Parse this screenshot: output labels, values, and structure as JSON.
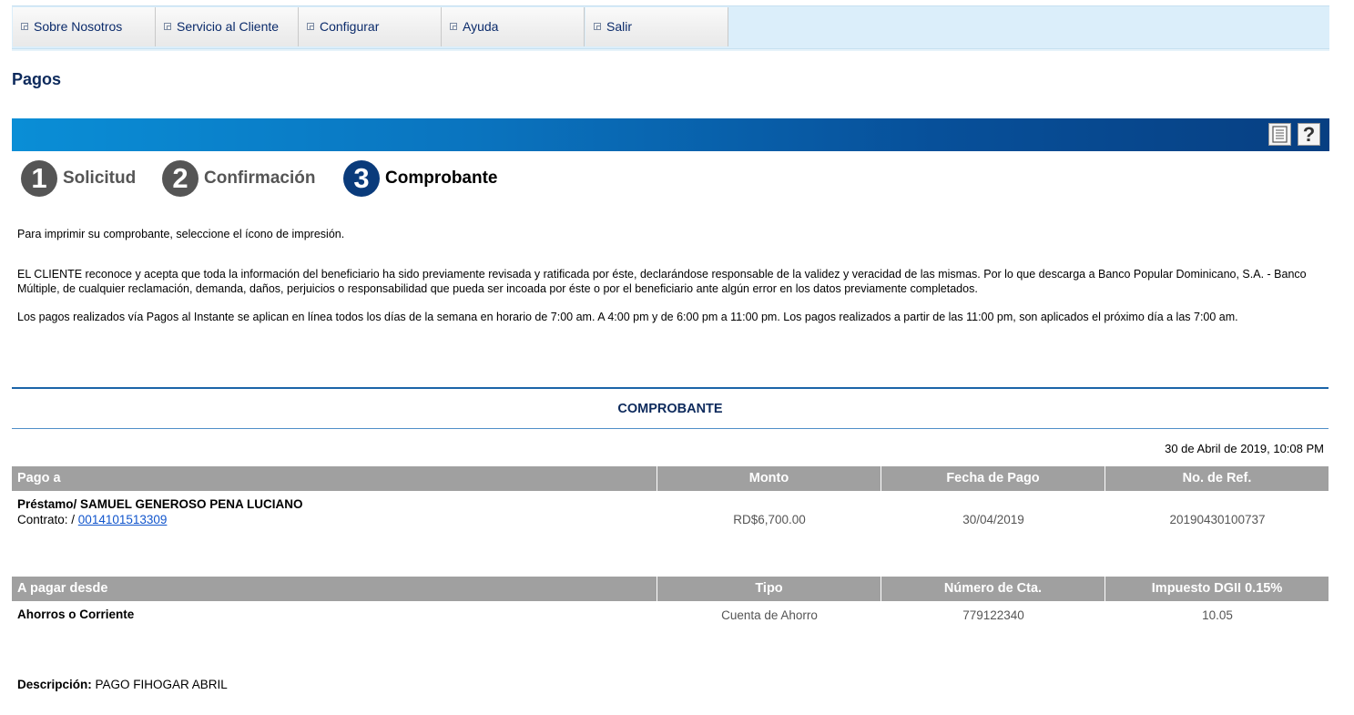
{
  "nav": {
    "items": [
      {
        "label": "Sobre Nosotros"
      },
      {
        "label": "Servicio al Cliente"
      },
      {
        "label": "Configurar"
      },
      {
        "label": "Ayuda"
      },
      {
        "label": "Salir"
      }
    ]
  },
  "page": {
    "title": "Pagos"
  },
  "steps": [
    {
      "number": "1",
      "label": "Solicitud"
    },
    {
      "number": "2",
      "label": "Confirmación"
    },
    {
      "number": "3",
      "label": "Comprobante"
    }
  ],
  "info": {
    "print_note": "Para imprimir su comprobante, seleccione el ícono de impresión.",
    "disclaimer": "EL CLIENTE reconoce y acepta que toda la información del beneficiario ha sido previamente revisada y ratificada por éste, declarándose responsable de la validez y veracidad de las mismas. Por lo que descarga a Banco Popular Dominicano, S.A. - Banco Múltiple, de cualquier reclamación, demanda, daños, perjuicios o responsabilidad que pueda ser incoada por éste o por el beneficiario ante algún error en los datos previamente completados.",
    "schedule": "Los pagos realizados vía Pagos al Instante se aplican en línea todos los días de la semana en horario de 7:00 am. A 4:00 pm y de 6:00 pm a 11:00 pm. Los pagos realizados a partir de las 11:00 pm, son aplicados el próximo día a las 7:00 am."
  },
  "receipt": {
    "title": "COMPROBANTE",
    "datetime": "30 de Abril de 2019, 10:08 PM",
    "payment_table": {
      "headers": [
        "Pago a",
        "Monto",
        "Fecha de Pago",
        "No. de Ref."
      ],
      "payee": "Préstamo/ SAMUEL GENEROSO PENA LUCIANO",
      "contract_label": "Contrato: / ",
      "contract_number": "0014101513309",
      "amount": "RD$6,700.00",
      "date": "30/04/2019",
      "reference": "20190430100737"
    },
    "source_table": {
      "headers": [
        "A pagar desde",
        "Tipo",
        "Número de Cta.",
        "Impuesto DGII 0.15%"
      ],
      "source": "Ahorros o Corriente",
      "type": "Cuenta de Ahorro",
      "account_number": "779122340",
      "tax": "10.05"
    },
    "description_label": "Descripción:",
    "description_value": " PAGO FIHOGAR ABRIL"
  }
}
